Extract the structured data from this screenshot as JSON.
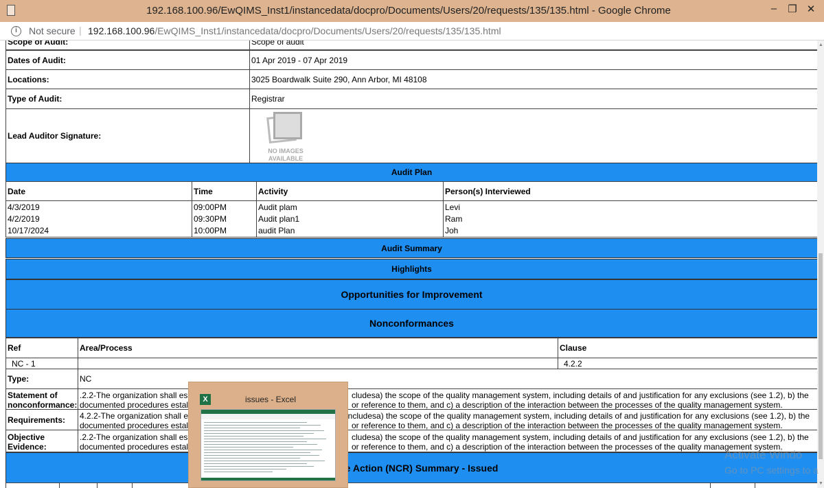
{
  "window": {
    "title": "192.168.100.96/EwQIMS_Inst1/instancedata/docpro/Documents/Users/20/requests/135/135.html - Google Chrome",
    "minimize": "–",
    "restore": "❐",
    "close": "✕"
  },
  "addressbar": {
    "security": "Not secure",
    "separator": "|",
    "host": "192.168.100.96",
    "path": "/EwQIMS_Inst1/instancedata/docpro/Documents/Users/20/requests/135/135.html"
  },
  "audit_info": {
    "scope_label": "Scope of Audit:",
    "scope_value": "Scope of audit",
    "dates_label": "Dates of Audit:",
    "dates_value": "01 Apr 2019 - 07 Apr 2019",
    "locations_label": "Locations:",
    "locations_value": "3025 Boardwalk Suite 290, Ann Arbor, MI 48108",
    "type_label": "Type of Audit:",
    "type_value": "Registrar",
    "signature_label": "Lead Auditor Signature:",
    "no_image_line1": "NO IMAGES",
    "no_image_line2": "AVAILABLE"
  },
  "audit_plan": {
    "heading": "Audit Plan",
    "columns": [
      "Date",
      "Time",
      "Activity",
      "Person(s) Interviewed"
    ],
    "rows": [
      [
        "4/3/2019",
        "09:00PM",
        "Audit plam",
        "Levi"
      ],
      [
        "4/2/2019",
        "09:30PM",
        "Audit plan1",
        "Ram"
      ],
      [
        "10/17/2024",
        "10:00PM",
        "audit Plan",
        "Joh"
      ]
    ]
  },
  "sections": {
    "audit_summary": "Audit Summary",
    "highlights": "Highlights",
    "opportunities": "Opportunities for Improvement",
    "nonconformances": "Nonconformances",
    "ncr_summary": "ive Action (NCR) Summary - Issued"
  },
  "nonconformance": {
    "ref_label": "Ref",
    "area_label": "Area/Process",
    "clause_label": "Clause",
    "ref_value": "NC - 1",
    "clause_value": "4.2.2",
    "type_label": "Type:",
    "type_value": "NC",
    "statement_label_1": "Statement of",
    "statement_label_2": "nonconformance:",
    "statement_line1": ".2.2-The organization shall es",
    "statement_line1b": "cludesa) the scope of the quality management system, including details of and justification for any exclusions (see 1.2), b) the",
    "statement_line2": "documented procedures estal",
    "statement_line2b": "or reference to them, and c) a description of the interaction between the processes of the quality management system.",
    "requirements_label": "Requirements:",
    "requirements_line1": "4.2.2-The organization shall e",
    "requirements_line1b": "includesa) the scope of the quality management system, including details of and justification for any exclusions (see 1.2), b) the",
    "requirements_line2": "documented procedures estal",
    "requirements_line2b": "or reference to them, and c) a description of the interaction between the processes of the quality management system.",
    "evidence_label_1": "Objective",
    "evidence_label_2": "Evidence:",
    "evidence_line1": ".2.2-The organization shall es",
    "evidence_line1b": "cludesa) the scope of the quality management system, including details of and justification for any exclusions (see 1.2), b) the",
    "evidence_line2": "documented procedures estal",
    "evidence_line2b": "or reference to them, and c) a description of the interaction between the processes of the quality management system."
  },
  "taskbar_preview": {
    "icon_letter": "X",
    "title": "issues - Excel"
  },
  "watermark": {
    "line1": "Activate Windo",
    "line2": "Go to PC settings to a"
  },
  "colors": {
    "section_blue": "#1f8ef1",
    "titlebar": "#ddb390",
    "excel_green": "#1e7145"
  }
}
